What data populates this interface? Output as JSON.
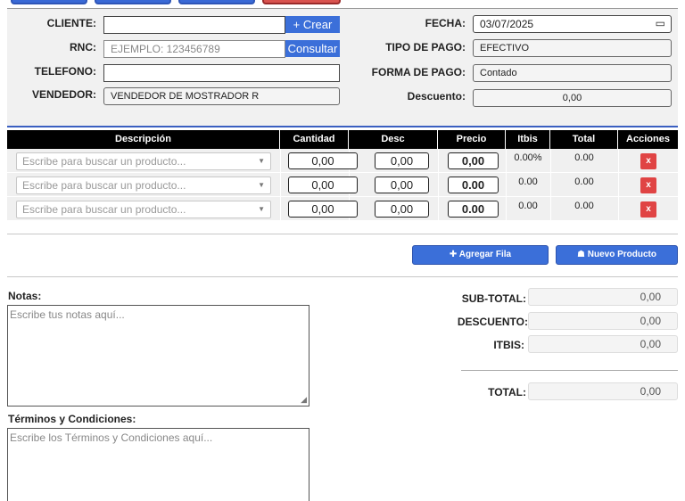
{
  "header": {
    "cliente_label": "CLIENTE:",
    "crear_label": "+ Crear",
    "rnc_label": "RNC:",
    "rnc_placeholder": "EJEMPLO: 123456789",
    "consultar_label": "Consultar",
    "telefono_label": "TELEFONO:",
    "vendedor_label": "VENDEDOR:",
    "vendedor_value": "VENDEDOR DE MOSTRADOR R",
    "fecha_label": "FECHA:",
    "fecha_value": "03/07/2025",
    "tipo_pago_label": "TIPO DE PAGO:",
    "tipo_pago_value": "EFECTIVO",
    "forma_pago_label": "FORMA DE PAGO:",
    "forma_pago_value": "Contado",
    "descuento_label": "Descuento:",
    "descuento_value": "0,00"
  },
  "table": {
    "columns": [
      "Descripción",
      "Cantidad",
      "Desc",
      "Precio",
      "Itbis",
      "Total",
      "Acciones"
    ],
    "rows": [
      {
        "product_placeholder": "Escribe para buscar un producto...",
        "cantidad": "0,00",
        "desc": "0,00",
        "precio": "0,00",
        "itbis": "0.00%",
        "total": "0.00",
        "action": "x"
      },
      {
        "product_placeholder": "Escribe para buscar un producto...",
        "cantidad": "0,00",
        "desc": "0,00",
        "precio": "0.00",
        "itbis": "0.00",
        "total": "0.00",
        "action": "x"
      },
      {
        "product_placeholder": "Escribe para buscar un producto...",
        "cantidad": "0,00",
        "desc": "0,00",
        "precio": "0.00",
        "itbis": "0.00",
        "total": "0.00",
        "action": "x"
      }
    ]
  },
  "actions": {
    "add_row": "Agregar Fila",
    "new_product": "Nuevo Producto"
  },
  "notes": {
    "label": "Notas:",
    "placeholder": "Escribe tus notas aquí..."
  },
  "terms": {
    "label": "Términos y Condiciones:",
    "placeholder": "Escribe los Términos y Condiciones aquí..."
  },
  "totals": {
    "subtotal_label": "SUB-TOTAL:",
    "subtotal_value": "0,00",
    "descuento_label": "DESCUENTO:",
    "descuento_value": "0,00",
    "itbis_label": "ITBIS:",
    "itbis_value": "0,00",
    "total_label": "TOTAL:",
    "total_value": "0,00"
  },
  "colors": {
    "accent": "#3b6fd9",
    "danger": "#e04444",
    "header_bg": "#000000"
  }
}
